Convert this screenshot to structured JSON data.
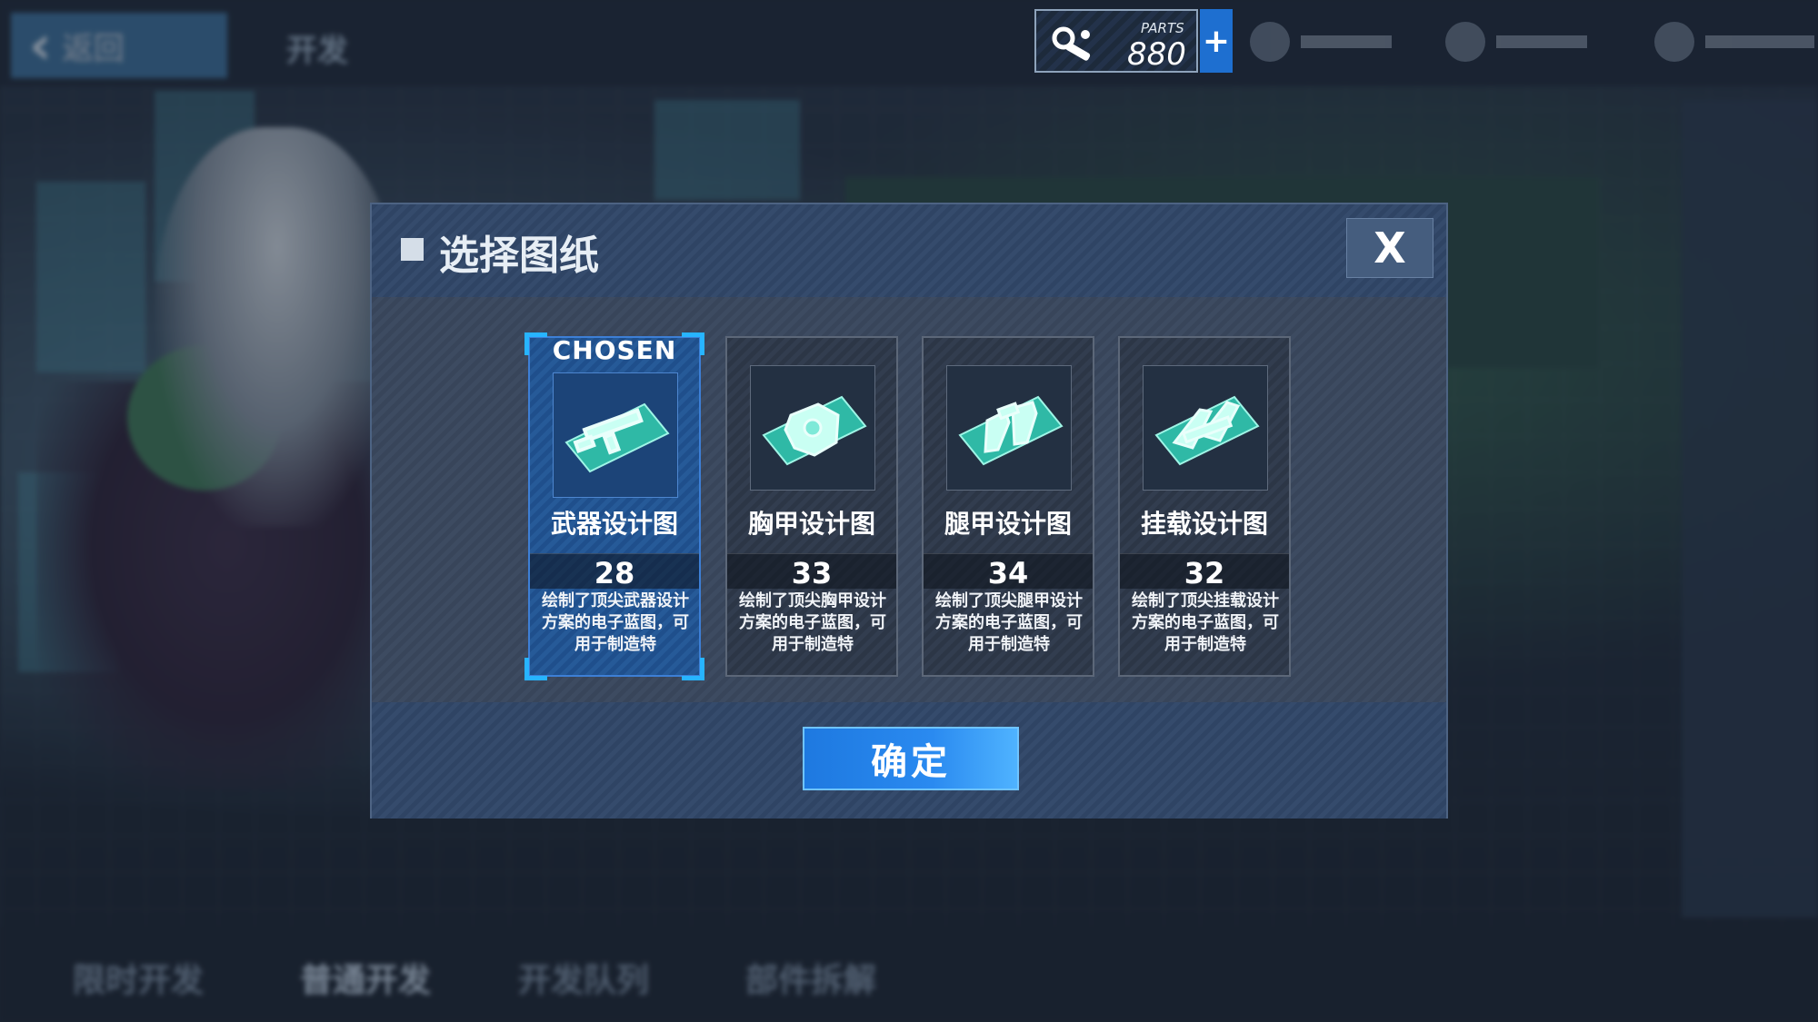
{
  "background": {
    "back_label": "返回",
    "page_title": "开发",
    "bottom_tabs": [
      "限时开发",
      "普通开发",
      "开发队列",
      "部件拆解"
    ],
    "active_tab_index": 1
  },
  "top_bar": {
    "parts_label": "PARTS",
    "parts_value": "880",
    "add_symbol": "+"
  },
  "modal": {
    "title": "选择图纸",
    "close_symbol": "X",
    "confirm_label": "确定",
    "chosen_label": "CHOSEN",
    "selected_index": 0,
    "blueprints": [
      {
        "name": "武器设计图",
        "count": "28",
        "description": "绘制了顶尖武器设计方案的电子蓝图，可用于制造特",
        "icon": "weapon-blueprint-icon"
      },
      {
        "name": "胸甲设计图",
        "count": "33",
        "description": "绘制了顶尖胸甲设计方案的电子蓝图，可用于制造特",
        "icon": "chest-armor-blueprint-icon"
      },
      {
        "name": "腿甲设计图",
        "count": "34",
        "description": "绘制了顶尖腿甲设计方案的电子蓝图，可用于制造特",
        "icon": "leg-armor-blueprint-icon"
      },
      {
        "name": "挂载设计图",
        "count": "32",
        "description": "绘制了顶尖挂载设计方案的电子蓝图，可用于制造特",
        "icon": "mount-blueprint-icon"
      }
    ]
  },
  "colors": {
    "accent_blue": "#1e79e0",
    "chosen_corner": "#27b4ff",
    "blueprint_cyan": "#4fe0d0"
  }
}
